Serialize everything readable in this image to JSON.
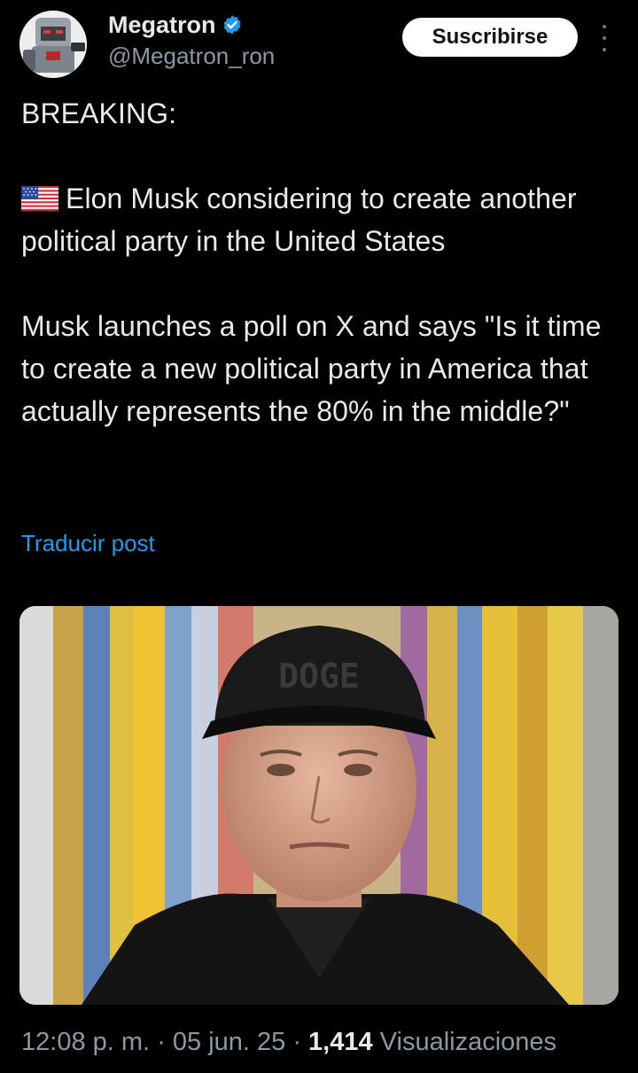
{
  "author": {
    "display_name": "Megatron",
    "handle": "@Megatron_ron",
    "verified": true,
    "avatar_icon": "megatron-avatar"
  },
  "actions": {
    "subscribe_label": "Suscribirse",
    "more_icon": "vertical-ellipsis-icon"
  },
  "post": {
    "line1": "BREAKING:",
    "flag_icon": "us-flag-icon",
    "para2": "Elon Musk considering to create another political party in the United States",
    "para3": "Musk launches a poll on X and says \"Is it time to create a new political party in America that actually represents the 80% in the middle?\""
  },
  "translate_label": "Traducir post",
  "media": {
    "cap_text": "DOGE"
  },
  "meta": {
    "time": "12:08 p. m.",
    "sep1": " · ",
    "date": "05 jun. 25",
    "sep2": " · ",
    "views": "1,414",
    "views_label": " Visualizaciones"
  },
  "colors": {
    "background": "#000000",
    "text": "#e7e9ea",
    "secondary": "#8b98a5",
    "link": "#1d9bf0",
    "button_bg": "#ffffff"
  }
}
